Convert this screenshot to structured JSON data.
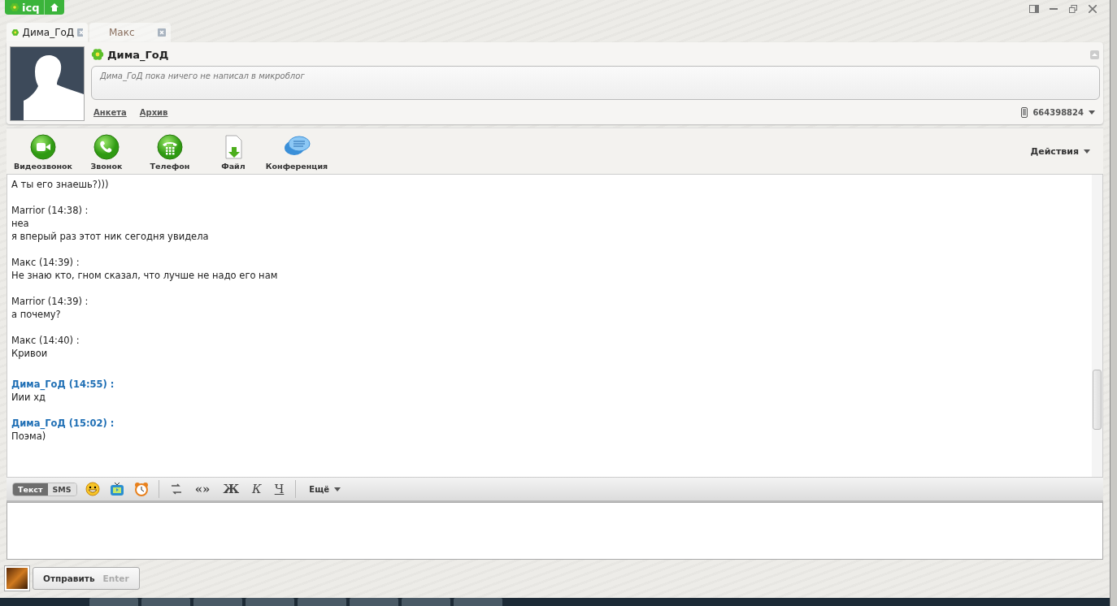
{
  "app": {
    "logo": "icq"
  },
  "tabs": [
    {
      "label": "Дима_ГоД",
      "selected": true,
      "online": true
    },
    {
      "label": "Макс",
      "selected": false,
      "online": false
    }
  ],
  "profile": {
    "name": "Дима_ГоД",
    "online": true,
    "status_text": "Дима_ГоД пока ничего не написал в микроблог",
    "links": [
      "Анкета",
      "Архив"
    ],
    "phone": "664398824"
  },
  "actions": [
    {
      "kind": "video",
      "label": "Видеозвонок"
    },
    {
      "kind": "call",
      "label": "Звонок"
    },
    {
      "kind": "phone",
      "label": "Телефон"
    },
    {
      "kind": "file",
      "label": "Файл"
    },
    {
      "kind": "conference",
      "label": "Конференция"
    }
  ],
  "actions_menu": "Действия",
  "messages": [
    {
      "lines": [
        "А ты его знаешь?)))"
      ]
    },
    {
      "sender": "Marrior (14:38) :",
      "mine": false,
      "lines": [
        "неа",
        "я вперый раз этот ник сегодня увидела"
      ]
    },
    {
      "sender": "Макс (14:39) :",
      "mine": false,
      "lines": [
        "Не знаю кто, гном сказал, что лучше не надо его нам"
      ]
    },
    {
      "sender": "Marrior (14:39) :",
      "mine": false,
      "lines": [
        "а почему?"
      ]
    },
    {
      "sender": "Макс (14:40) :",
      "mine": false,
      "lines": [
        "Кривои"
      ]
    },
    {
      "sender": "Дима_ГоД (14:55) :",
      "mine": true,
      "lines": [
        "Иии хд"
      ]
    },
    {
      "sender": "Дима_ГоД (15:02) :",
      "mine": true,
      "lines": [
        "Поэма)"
      ]
    }
  ],
  "composer": {
    "modes": [
      {
        "label": "Текст",
        "selected": true
      },
      {
        "label": "SMS",
        "selected": false
      }
    ],
    "format": [
      {
        "kind": "quote",
        "label": "«»"
      },
      {
        "kind": "bold",
        "label": "Ж"
      },
      {
        "kind": "italic",
        "label": "К"
      },
      {
        "kind": "underline",
        "label": "Ч"
      }
    ],
    "more": "Ещё"
  },
  "send": {
    "label": "Отправить",
    "hint": "Enter"
  }
}
